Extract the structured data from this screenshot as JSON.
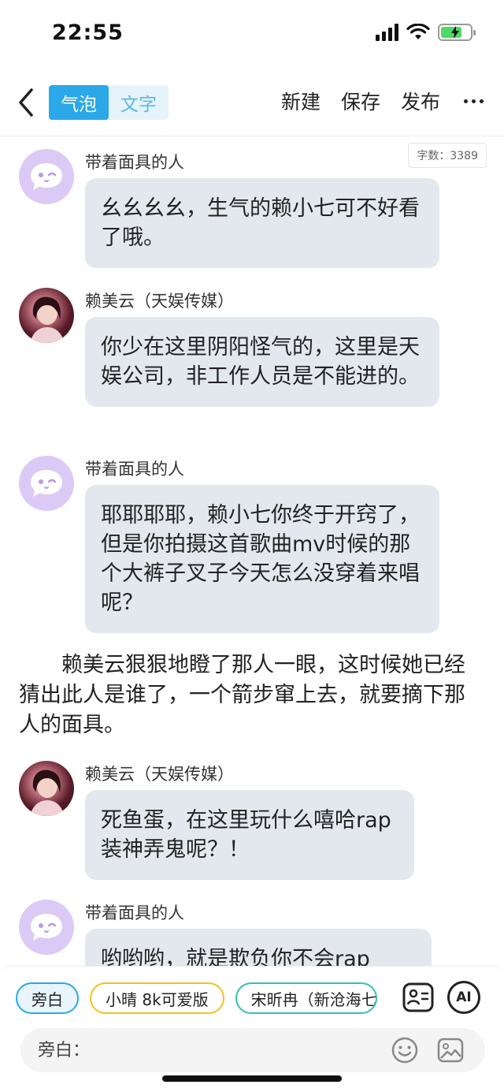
{
  "status": {
    "time": "22:55"
  },
  "nav": {
    "mode_bubble": "气泡",
    "mode_text": "文字",
    "new_label": "新建",
    "save_label": "保存",
    "publish_label": "发布"
  },
  "word_count": "字数：3389",
  "messages": [
    {
      "sender": "带着面具的人",
      "text": "幺幺幺幺，生气的赖小七可不好看了哦。"
    },
    {
      "sender": "赖美云（天娱传媒）",
      "text": "你少在这里阴阳怪气的，这里是天娱公司，非工作人员是不能进的。"
    },
    {
      "sender": "带着面具的人",
      "text": "耶耶耶耶，赖小七你终于开窍了，但是你拍摄这首歌曲mv时候的那个大裤子叉子今天怎么没穿着来唱呢？"
    },
    {
      "sender": "赖美云（天娱传媒）",
      "text": "死鱼蛋，在这里玩什么嘻哈rap装神弄鬼呢？！"
    },
    {
      "sender": "带着面具的人",
      "text": "哟哟哟，就是欺负你不会rap"
    }
  ],
  "narration": "赖美云狠狠地瞪了那人一眼，这时候她已经猜出此人是谁了，一个箭步窜上去，就要摘下那人的面具。",
  "roles": [
    "旁白",
    "小晴 8k可爱版",
    "宋昕冉（新沧海七"
  ],
  "ai_label": "AI",
  "input": {
    "placeholder": "旁白："
  },
  "colors": {
    "accent": "#2aa8e8",
    "bubble": "#e3e8ef",
    "mask_avatar": "#dccaf6"
  }
}
